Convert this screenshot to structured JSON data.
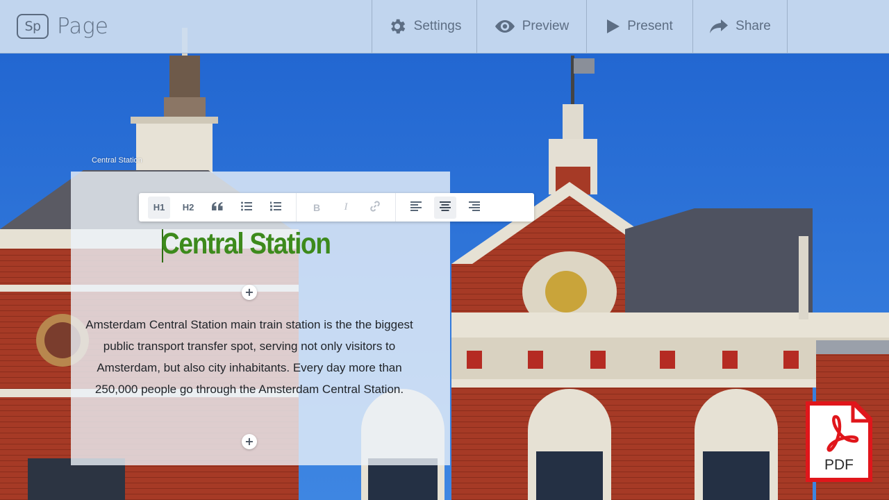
{
  "app": {
    "logo_text": "Sp",
    "title": "Page"
  },
  "nav": {
    "settings_label": "Settings",
    "preview_label": "Preview",
    "present_label": "Present",
    "share_label": "Share",
    "icons": [
      "gear-icon",
      "eye-icon",
      "play-icon",
      "share-arrow-icon"
    ]
  },
  "editor": {
    "block_caption": "Central Station",
    "toolbar": {
      "h1_label": "H1",
      "h2_label": "H2",
      "active_heading": "H1",
      "active_alignment": "center",
      "icons": [
        "quote-icon",
        "bulleted-list-icon",
        "numbered-list-icon",
        "bold-icon",
        "italic-icon",
        "link-icon",
        "align-left-icon",
        "align-center-icon",
        "align-right-icon"
      ]
    },
    "headline": "Central Station",
    "body": "Amsterdam Central Station main train station is the the biggest public transport transfer spot, serving not only visitors to Amsterdam, but also city inhabitants. Every day more than 250,000 people go through the Amsterdam Central Station.",
    "add_symbol": "+"
  },
  "pdf_badge": {
    "label": "PDF"
  },
  "colors": {
    "headline": "#3d8a1c",
    "topbar": "#cedef0",
    "sky": "#2a6fd6",
    "brick": "#a63a26",
    "pdf_red": "#e0161b"
  }
}
